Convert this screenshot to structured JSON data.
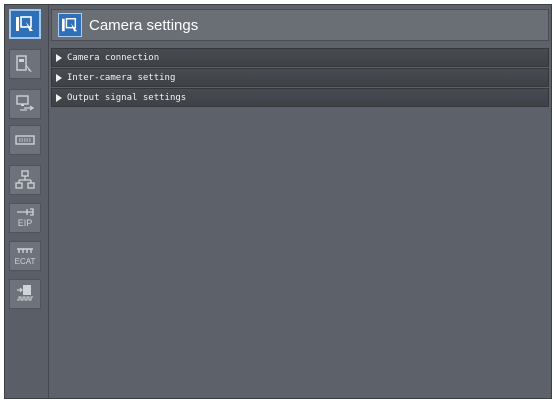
{
  "header": {
    "title": "Camera settings",
    "icon": "camera-settings-icon"
  },
  "sidebar": {
    "items": [
      {
        "icon": "camera-settings-icon",
        "active": true
      },
      {
        "icon": "image-adjustment-icon",
        "active": false
      },
      {
        "icon": "screen-transfer-icon",
        "active": false
      },
      {
        "icon": "keyboard-icon",
        "active": false
      },
      {
        "icon": "network-icon",
        "active": false
      },
      {
        "icon": "eip-icon",
        "label": "EIP",
        "active": false
      },
      {
        "icon": "ecat-icon",
        "label": "ECAT",
        "active": false
      },
      {
        "icon": "io-signal-icon",
        "active": false
      }
    ]
  },
  "sections": [
    {
      "label": "Camera connection"
    },
    {
      "label": "Inter-camera setting"
    },
    {
      "label": "Output signal settings"
    }
  ],
  "colors": {
    "accent": "#2f6fb8",
    "panel": "#5d6169"
  }
}
